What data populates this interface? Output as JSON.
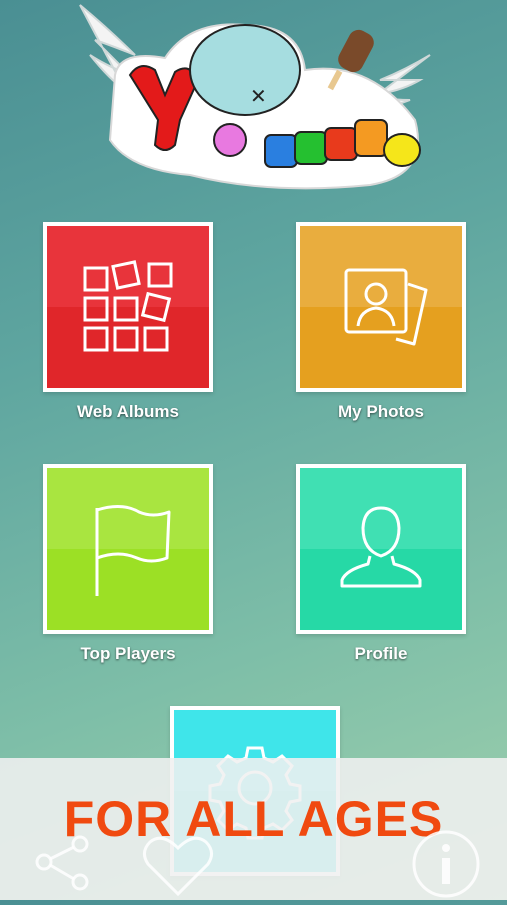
{
  "logo": {
    "text": "YoPuzzle"
  },
  "tiles": [
    {
      "label": "Web Albums",
      "top_color": "#e8343b",
      "bottom_color": "#e0262a",
      "icon": "grid-icon"
    },
    {
      "label": "My Photos",
      "top_color": "#e9ad3e",
      "bottom_color": "#e5a01f",
      "icon": "photo-icon"
    },
    {
      "label": "Top Players",
      "top_color": "#a9e540",
      "bottom_color": "#9ce025",
      "icon": "flag-icon"
    },
    {
      "label": "Profile",
      "top_color": "#40e0b3",
      "bottom_color": "#26d9a6",
      "icon": "person-icon"
    },
    {
      "label": "",
      "top_color": "#3fe5ea",
      "bottom_color": "#2ed8de",
      "icon": "gear-icon"
    }
  ],
  "banner": {
    "text": "FOR ALL AGES",
    "color": "#f04a10"
  },
  "bottom_bar": {
    "icons": [
      "share-icon",
      "heart-icon",
      "info-icon"
    ]
  }
}
